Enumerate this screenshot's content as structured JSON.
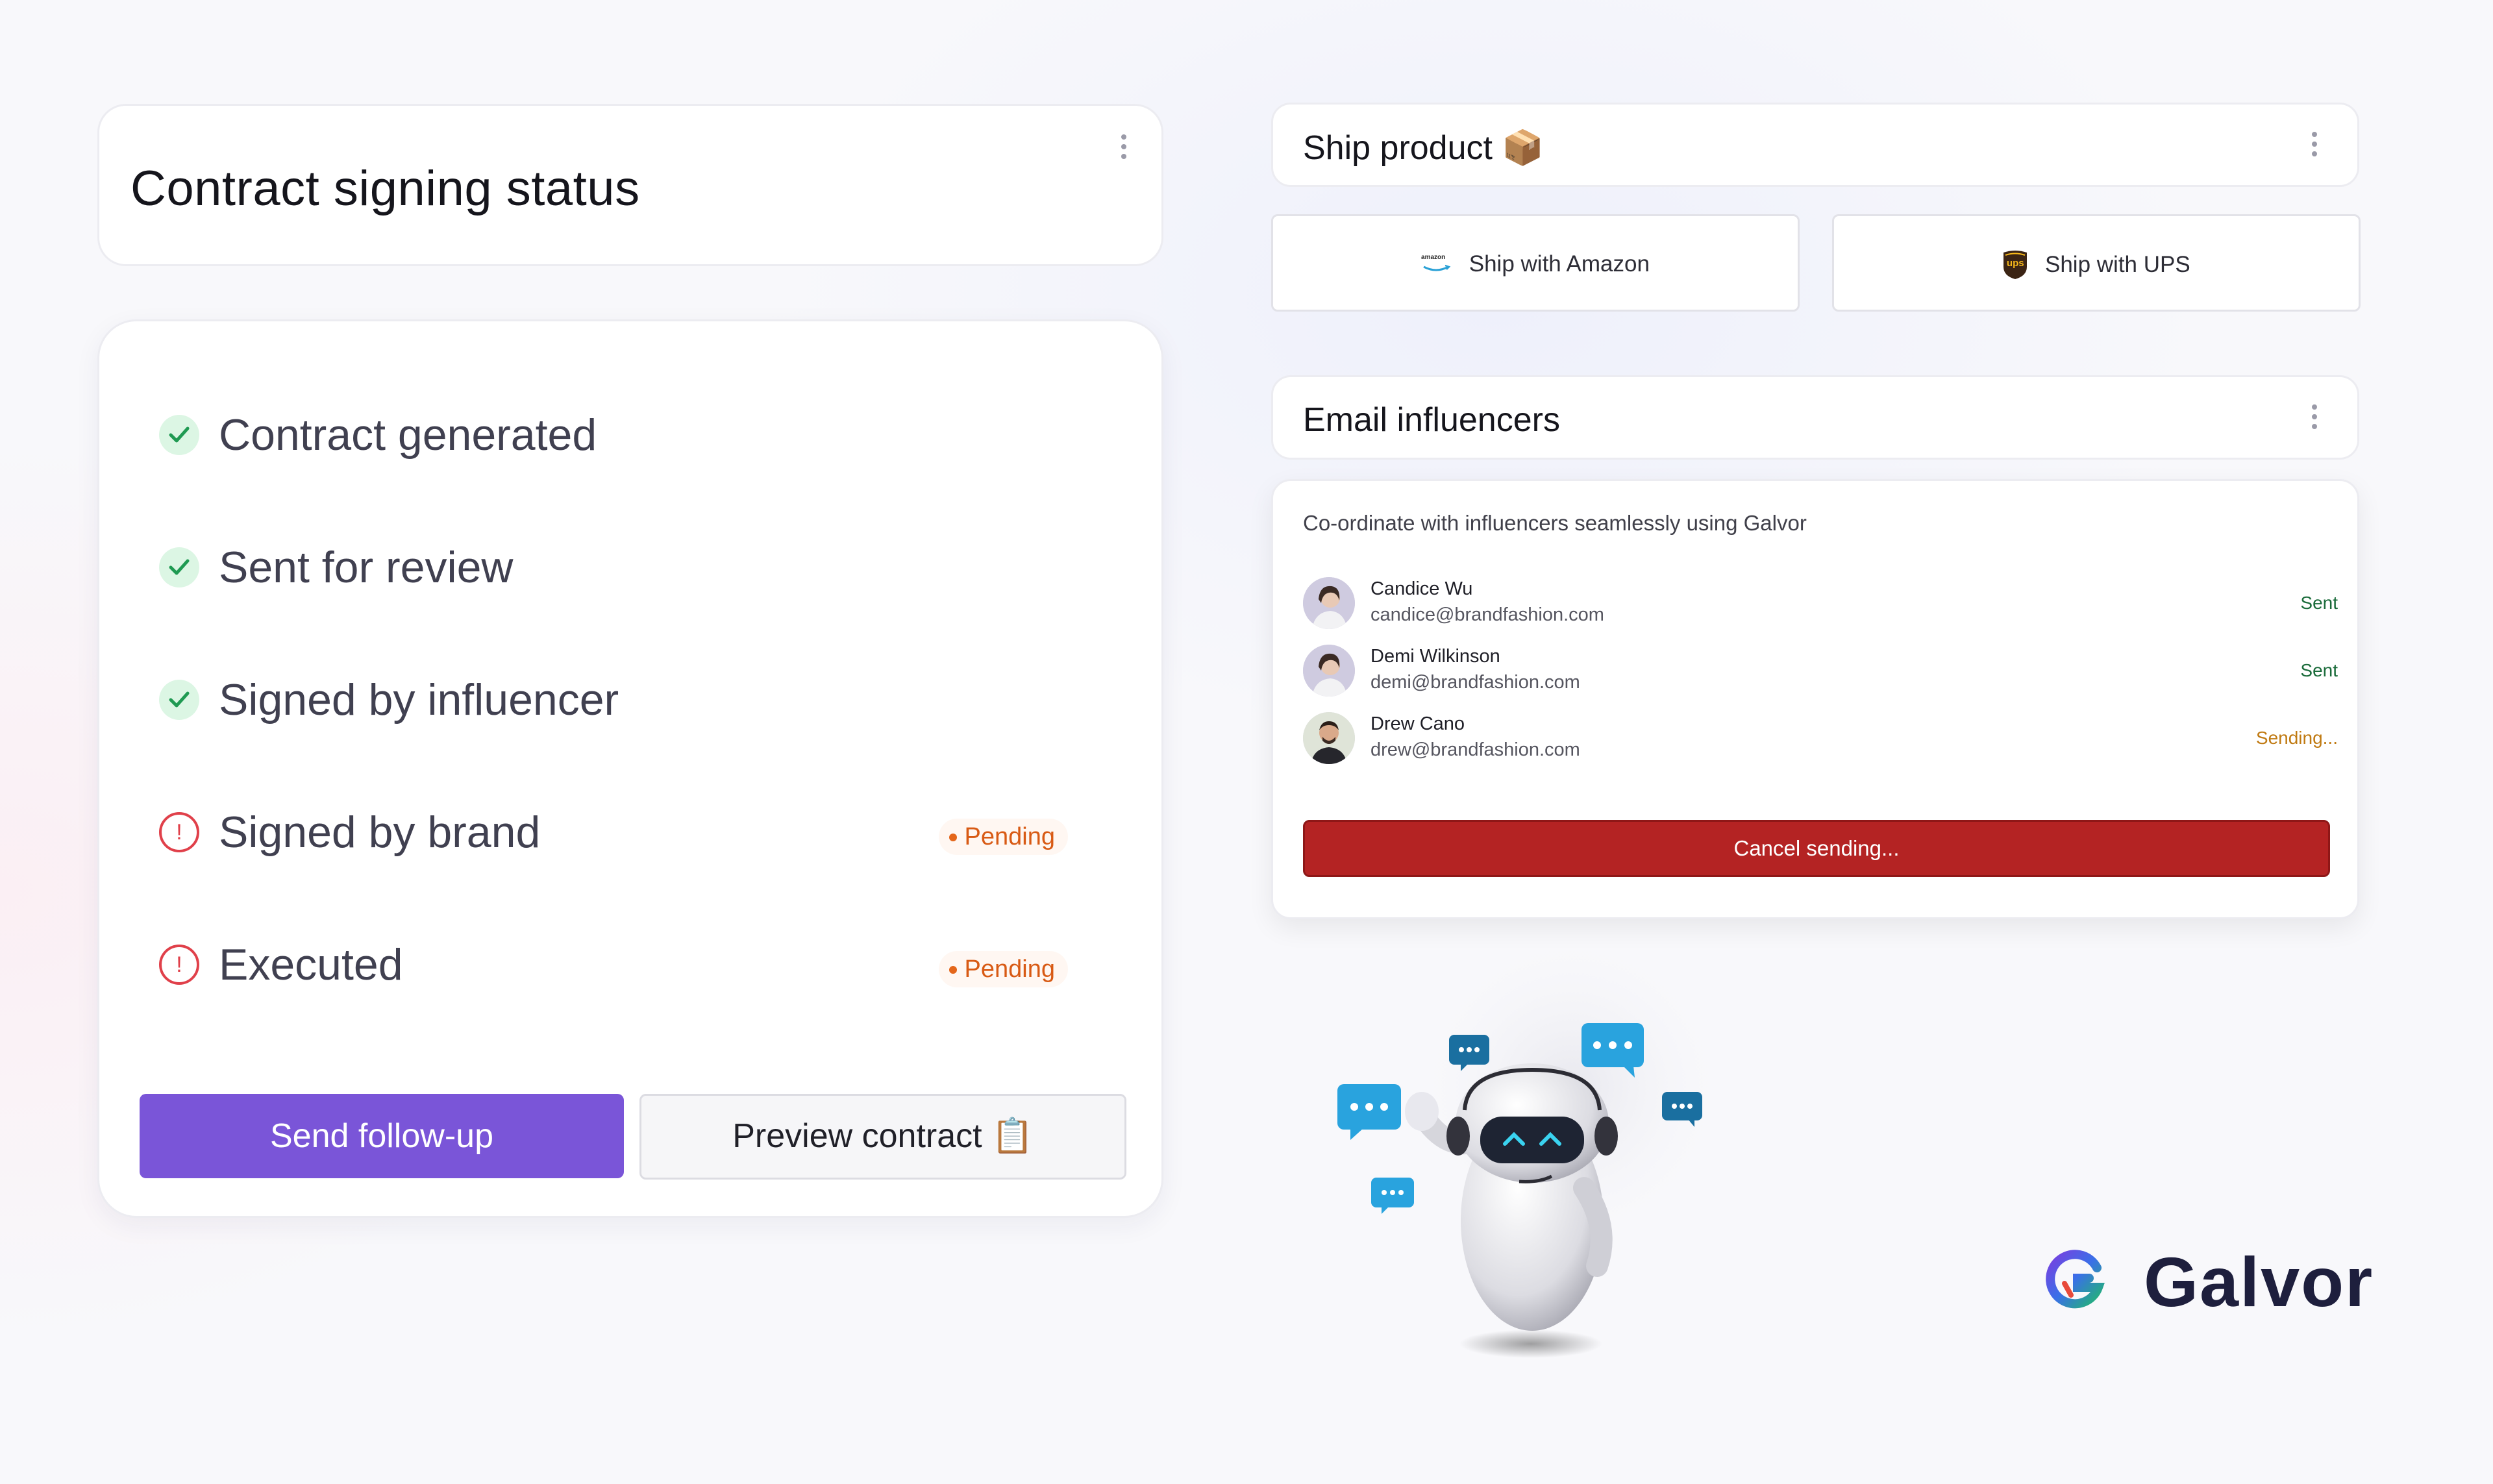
{
  "contract": {
    "title": "Contract signing status",
    "steps": [
      {
        "label": "Contract generated",
        "status": "done"
      },
      {
        "label": "Sent for review",
        "status": "done"
      },
      {
        "label": "Signed by influencer",
        "status": "done"
      },
      {
        "label": "Signed by brand",
        "status": "pending",
        "badge": "Pending"
      },
      {
        "label": "Executed",
        "status": "pending",
        "badge": "Pending"
      }
    ],
    "followup_label": "Send follow-up",
    "preview_label": "Preview contract 📋"
  },
  "ship": {
    "title": "Ship product 📦",
    "amazon_label": "Ship with Amazon",
    "ups_label": "Ship with UPS",
    "ups_logo_text": "ups",
    "amazon_logo_text": "amazon"
  },
  "email": {
    "title": "Email influencers",
    "subtitle": "Co-ordinate with influencers seamlessly using Galvor",
    "people": [
      {
        "name": "Candice Wu",
        "email": "candice@brandfashion.com",
        "status": "Sent"
      },
      {
        "name": "Demi Wilkinson",
        "email": "demi@brandfashion.com",
        "status": "Sent"
      },
      {
        "name": "Drew Cano",
        "email": "drew@brandfashion.com",
        "status": "Sending..."
      }
    ],
    "cancel_label": "Cancel sending..."
  },
  "brand": {
    "name": "Galvor"
  },
  "colors": {
    "accent_purple": "#7a55d8",
    "cancel_red": "#b42323",
    "success_green": "#1a6b3a",
    "pending_orange": "#d85a14",
    "chat_blue": "#29a3de"
  },
  "icons": {
    "done": "check-circle-icon",
    "pending": "alert-circle-icon",
    "menu": "kebab-menu-icon"
  }
}
